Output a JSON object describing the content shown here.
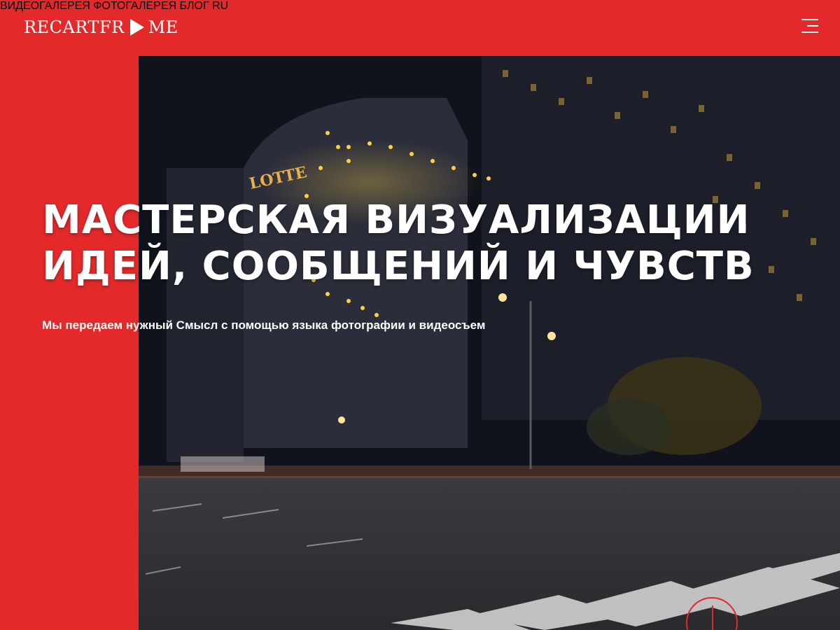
{
  "header": {
    "logo_left": "RECARTFR",
    "logo_right": "ME",
    "nav": [
      {
        "label": "ВИДЕОГАЛЕРЕЯ"
      },
      {
        "label": "ФОТОГАЛЕРЕЯ"
      },
      {
        "label": "БЛОГ"
      },
      {
        "label": "RU"
      }
    ],
    "menu_icon": "hamburger-icon"
  },
  "hero": {
    "title_line1": "МАСТЕРСКАЯ ВИЗУАЛИЗАЦИИ",
    "title_line2": "ИДЕЙ, СООБЩЕНИЙ И ЧУВСТВ",
    "subtitle": "Мы передаем нужный Смысл с помощью языка фотографии и видеосъем",
    "building_sign": "LOTTE",
    "scroll_icon": "scroll-down-icon"
  },
  "colors": {
    "brand_red": "#e3292a",
    "text": "#ffffff"
  }
}
